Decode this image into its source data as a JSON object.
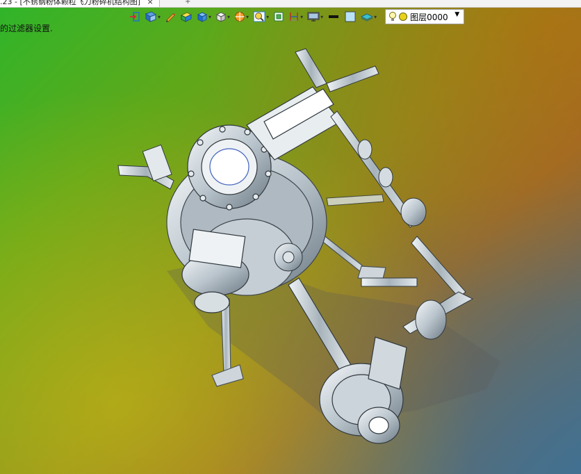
{
  "document_tab": {
    "title": ".23 - [不锈钢粉体颗粒飞刀粉碎机结构图]",
    "close_glyph": "×",
    "new_tab_glyph": "+"
  },
  "status": {
    "message": "的过滤器设置."
  },
  "toolbar": {
    "items": [
      {
        "icon": "exit-sketch-icon",
        "dropdown": false
      },
      {
        "icon": "view-orient-icon",
        "dropdown": true
      },
      {
        "icon": "pencil-icon",
        "dropdown": false
      },
      {
        "icon": "shaded-box-icon",
        "dropdown": false
      },
      {
        "icon": "cube-icon",
        "dropdown": true
      },
      {
        "icon": "white-cube-icon",
        "dropdown": true
      },
      {
        "icon": "section-view-icon",
        "dropdown": true
      },
      {
        "icon": "zoom-lens-icon",
        "dropdown": true
      },
      {
        "icon": "fit-view-icon",
        "dropdown": false
      },
      {
        "icon": "dimension-icon",
        "dropdown": true
      },
      {
        "icon": "monitor-icon",
        "dropdown": true
      },
      {
        "icon": "line-color-icon",
        "dropdown": false
      },
      {
        "icon": "fill-color-icon",
        "dropdown": false
      },
      {
        "icon": "layer-tool-icon",
        "dropdown": true
      }
    ],
    "dropdown_glyph": "▾",
    "layer": {
      "name": "图层0000",
      "arrow": "▼"
    }
  },
  "colors": {
    "toolbar_blue": "#1f6fd1",
    "tab_bg": "#ffffff",
    "metal": "#c9d2d8"
  }
}
